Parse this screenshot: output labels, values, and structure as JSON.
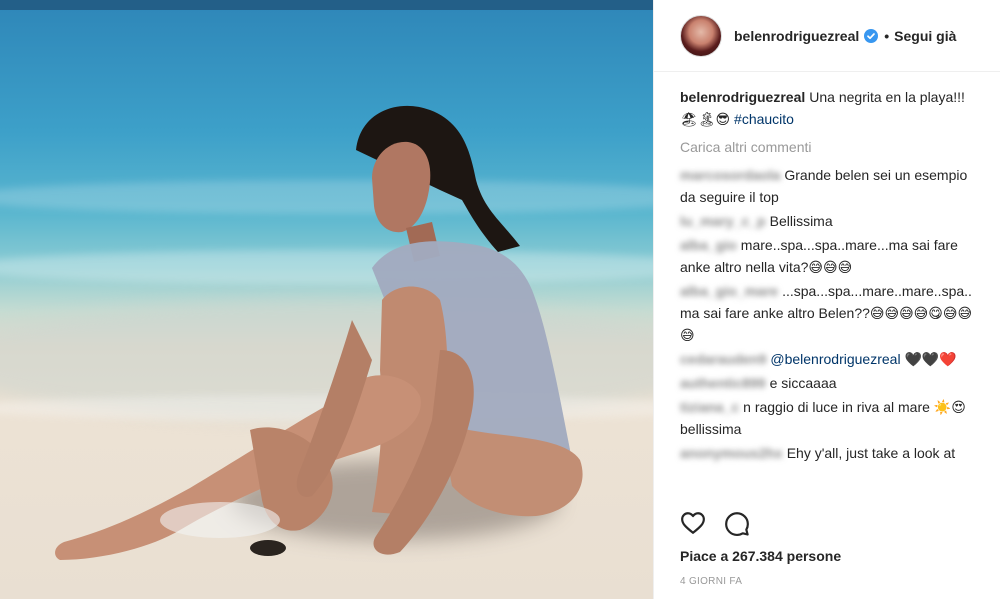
{
  "header": {
    "username": "belenrodriguezreal",
    "separator": "•",
    "follow_label": "Segui già"
  },
  "caption": {
    "username": "belenrodriguezreal",
    "text": "Una negrita en la playa!!! 🏖🏝😎 ",
    "hashtag": "#chaucito"
  },
  "load_more_label": "Carica altri commenti",
  "comments": [
    {
      "username": "marcosordaola",
      "text": "Grande belen sei un esempio da seguire il top"
    },
    {
      "username": "lu_mary_c_p",
      "text": "Bellissima"
    },
    {
      "username": "alba_gio",
      "text": "mare..spa...spa..mare...ma sai fare anke altro nella vita?😅😅😅"
    },
    {
      "username": "alba_gio_mare",
      "text": "...spa...spa...mare..mare..spa.. ma sai fare anke altro Belen??😅😅😅😅😋😅😅😅"
    },
    {
      "username": "cedarauden9",
      "mention": "@belenrodriguezreal",
      "text": " 🖤🖤❤️"
    },
    {
      "username": "authentic899",
      "text": "e siccaaaa"
    },
    {
      "username": "tiziana_c",
      "text": "n raggio di luce in riva al mare ☀️😍 bellissima"
    },
    {
      "username": "anonymous2hx",
      "text": "Ehy y'all, just take a look at"
    }
  ],
  "actions": {
    "like_icon": "heart-outline-icon",
    "comment_icon": "comment-bubble-icon"
  },
  "likes_label": "Piace a 267.384 persone",
  "timestamp": "4 GIORNI FA",
  "colors": {
    "link": "#003569",
    "verified": "#3897f0",
    "muted": "#999999"
  }
}
